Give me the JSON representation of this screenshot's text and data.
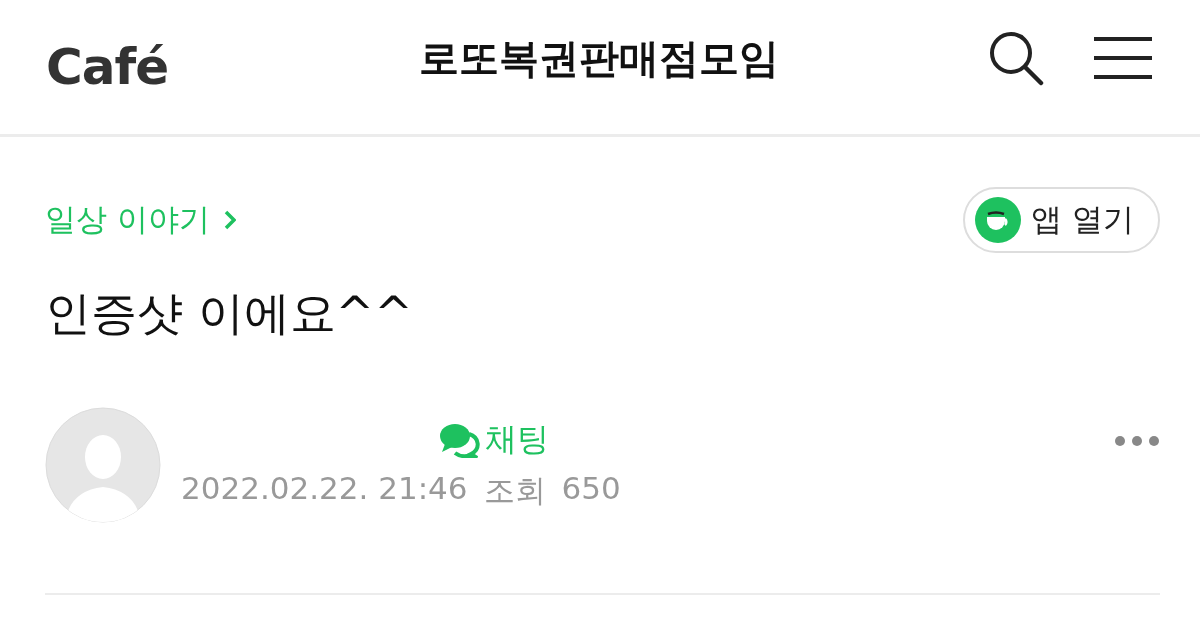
{
  "header": {
    "logo": "Café",
    "title": "로또복권판매점모임"
  },
  "post": {
    "category": "일상 이야기",
    "open_app_button": "앱 열기",
    "title": "인증샷 이에요^^",
    "author": {
      "chat_button": "채팅",
      "date": "2022.02.22. 21:46",
      "views_label": "조회",
      "views": "650"
    }
  }
}
